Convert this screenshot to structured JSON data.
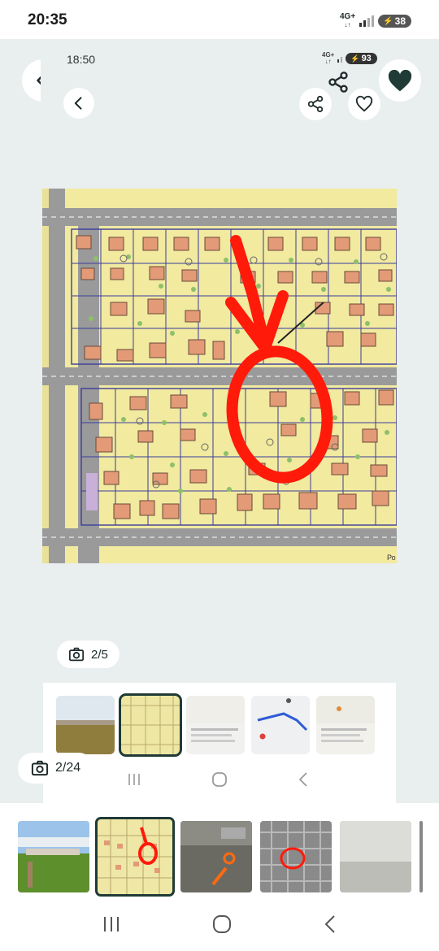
{
  "outer_status": {
    "time": "20:35",
    "network": "4G+",
    "battery": "38"
  },
  "inner_status": {
    "time": "18:50",
    "network": "4G+",
    "battery": "93"
  },
  "counters": {
    "inner": "2/5",
    "outer": "2/24"
  },
  "map_label": "Ро",
  "colors": {
    "accent": "#203a36",
    "annotation": "#ff1a0a",
    "map_base": "#f1ea9f"
  },
  "icons": [
    "back-icon",
    "share-icon",
    "heart-icon",
    "camera-icon",
    "recents-icon",
    "home-icon",
    "back-nav-icon"
  ]
}
